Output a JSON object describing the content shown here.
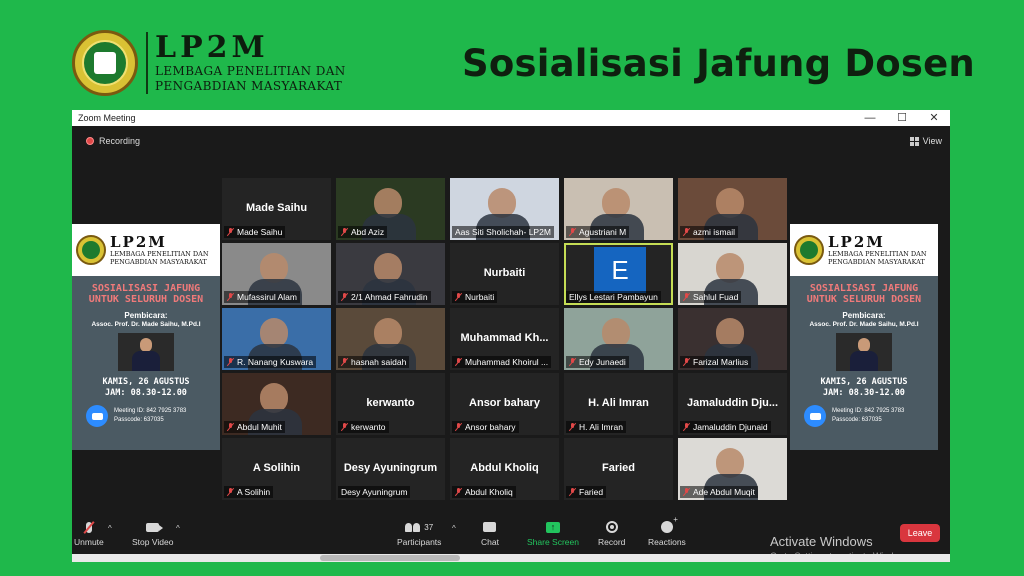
{
  "header": {
    "lp2m": "LP2M",
    "org_line1": "LEMBAGA PENELITIAN DAN",
    "org_line2": "PENGABDIAN MASYARAKAT",
    "title": "Sosialisasi Jafung Dosen"
  },
  "window": {
    "title": "Zoom Meeting",
    "minimize": "—",
    "maximize": "☐",
    "close": "✕",
    "recording": "Recording",
    "view": "View"
  },
  "poster": {
    "lp2m": "LP2M",
    "org_line1": "LEMBAGA PENELITIAN DAN",
    "org_line2": "PENGABDIAN MASYARAKAT",
    "headline1": "SOSIALISASI JAFUNG",
    "headline2": "UNTUK SELURUH DOSEN",
    "speaker_label": "Pembicara:",
    "speaker": "Assoc. Prof. Dr. Made Saihu, M.Pd.I",
    "date": "KAMIS, 26 AGUSTUS",
    "time": "JAM: 08.30-12.00",
    "meeting_id": "Meeting ID: 842 7925 3783",
    "passcode": "Passcode: 637035"
  },
  "tiles": [
    {
      "center": "Made Saihu",
      "label": "Made Saihu",
      "video": false
    },
    {
      "center": "",
      "label": "Abd Aziz",
      "video": true,
      "bg": "#2b3a22"
    },
    {
      "center": "",
      "label": "Aas Siti Sholichah- LP2M",
      "video": true,
      "bg": "#cfd6e0",
      "muted": false
    },
    {
      "center": "",
      "label": "Agustriani M",
      "video": true,
      "bg": "#c9bfb2"
    },
    {
      "center": "",
      "label": "azmi ismail",
      "video": true,
      "bg": "#6b4b3a"
    },
    {
      "center": "",
      "label": "Mufassirul Alam",
      "video": true,
      "bg": "#8a8a8a"
    },
    {
      "center": "",
      "label": "2/1 Ahmad Fahrudin",
      "video": true,
      "bg": "#3a3a40"
    },
    {
      "center": "Nurbaiti",
      "label": "Nurbaiti",
      "video": false
    },
    {
      "center": "",
      "label": "Ellys Lestari Pambayun",
      "video": false,
      "avatar": "E",
      "active": true,
      "muted": false
    },
    {
      "center": "",
      "label": "Sahlul Fuad",
      "video": true,
      "bg": "#d8d6d0"
    },
    {
      "center": "",
      "label": "R. Nanang Kuswara",
      "video": true,
      "bg": "#3a6ea8"
    },
    {
      "center": "",
      "label": "hasnah saidah",
      "video": true,
      "bg": "#5a4a3a"
    },
    {
      "center": "Muhammad Kh...",
      "label": "Muhammad Khoirul ...",
      "video": false
    },
    {
      "center": "",
      "label": "Edy Junaedi",
      "video": true,
      "bg": "#8fa39a"
    },
    {
      "center": "",
      "label": "Farizal Marlius",
      "video": true,
      "bg": "#3a3030"
    },
    {
      "center": "",
      "label": "Abdul Muhit",
      "video": true,
      "bg": "#3d2a22"
    },
    {
      "center": "kerwanto",
      "label": "kerwanto",
      "video": false
    },
    {
      "center": "Ansor bahary",
      "label": "Ansor bahary",
      "video": false
    },
    {
      "center": "H. Ali Imran",
      "label": "H. Ali Imran",
      "video": false
    },
    {
      "center": "Jamaluddin Dju...",
      "label": "Jamaluddin Djunaid",
      "video": false
    },
    {
      "center": "A Solihin",
      "label": "A Solihin",
      "video": false
    },
    {
      "center": "Desy Ayuningrum",
      "label": "Desy Ayuningrum",
      "video": false,
      "muted": false
    },
    {
      "center": "Abdul Kholiq",
      "label": "Abdul Kholiq",
      "video": false
    },
    {
      "center": "Faried",
      "label": "Faried",
      "video": false
    },
    {
      "center": "",
      "label": "Ade Abdul Muqit",
      "video": true,
      "bg": "#dcdad6"
    }
  ],
  "toolbar": {
    "unmute": "Unmute",
    "stop_video": "Stop Video",
    "participants": "Participants",
    "participant_count": "37",
    "chat": "Chat",
    "share_screen": "Share Screen",
    "record": "Record",
    "reactions": "Reactions",
    "leave": "Leave",
    "caret": "^"
  },
  "watermark": {
    "line1": "Activate Windows",
    "line2": "Go to Settings to activate Windows."
  },
  "colors": {
    "background": "#1fb84b",
    "zoom_dark": "#1a1a1a",
    "leave_red": "#d9363e",
    "share_green": "#22c55e",
    "active_speaker": "#c5dd55"
  }
}
